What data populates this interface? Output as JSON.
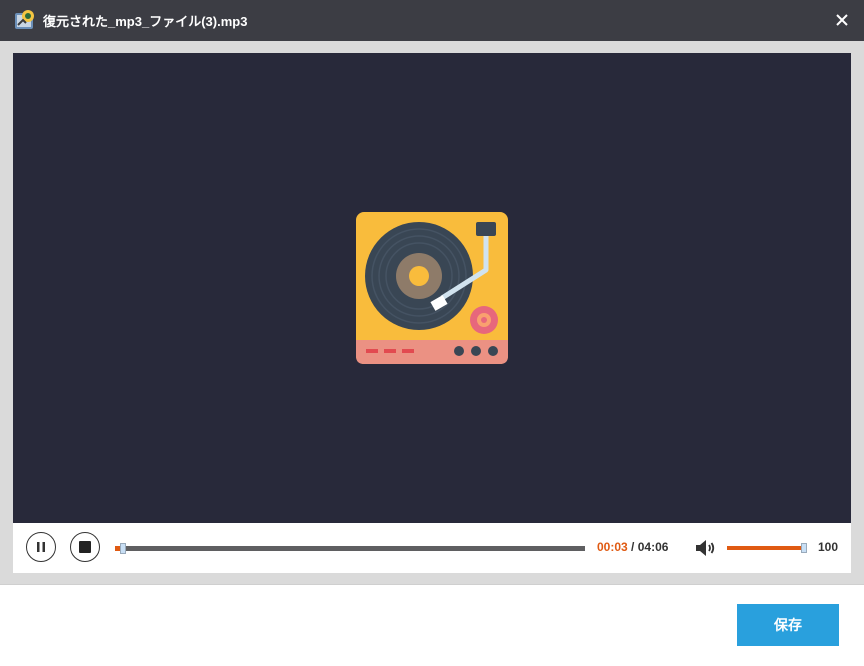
{
  "window": {
    "title": "復元された_mp3_ファイル(3).mp3",
    "app_icon": "recovery-app-icon",
    "close_icon": "close-icon"
  },
  "player": {
    "artwork_icon": "turntable-icon",
    "pause_icon": "pause-icon",
    "stop_icon": "stop-icon",
    "current_time": "00:03",
    "time_separator": "/",
    "total_time": "04:06",
    "progress_fraction": 0.012,
    "volume_icon": "speaker-icon",
    "volume_value": "100",
    "volume_fraction": 1.0,
    "accent_color": "#e05a12"
  },
  "footer": {
    "save_label": "保存",
    "button_color": "#29a0dd"
  }
}
